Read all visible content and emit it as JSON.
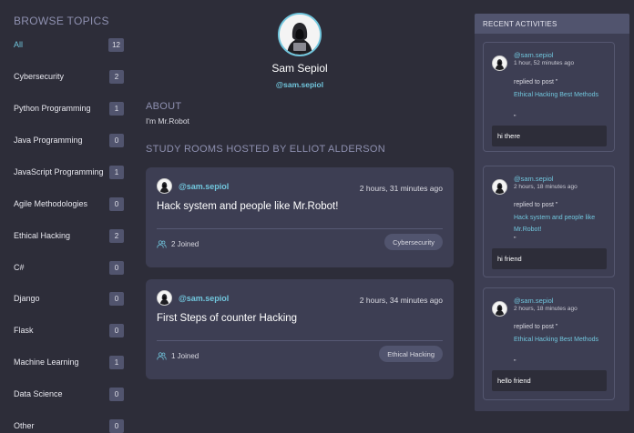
{
  "sidebar": {
    "title": "BROWSE TOPICS",
    "topics": [
      {
        "name": "All",
        "count": "12"
      },
      {
        "name": "Cybersecurity",
        "count": "2"
      },
      {
        "name": "Python Programming",
        "count": "1"
      },
      {
        "name": "Java Programming",
        "count": "0"
      },
      {
        "name": "JavaScript Programming",
        "count": "1"
      },
      {
        "name": "Agile Methodologies",
        "count": "0"
      },
      {
        "name": "Ethical Hacking",
        "count": "2"
      },
      {
        "name": "C#",
        "count": "0"
      },
      {
        "name": "Django",
        "count": "0"
      },
      {
        "name": "Flask",
        "count": "0"
      },
      {
        "name": "Machine Learning",
        "count": "1"
      },
      {
        "name": "Data Science",
        "count": "0"
      },
      {
        "name": "Other",
        "count": "0"
      }
    ]
  },
  "profile": {
    "name": "Sam Sepiol",
    "handle": "@sam.sepiol",
    "about_heading": "ABOUT",
    "about_text": "I'm Mr.Robot",
    "rooms_heading": "STUDY ROOMS HOSTED BY ELLIOT ALDERSON"
  },
  "rooms": [
    {
      "handle": "@sam.sepiol",
      "time": "2 hours, 31 minutes ago",
      "title": "Hack system and people like Mr.Robot!",
      "joined": "2 Joined",
      "topic": "Cybersecurity"
    },
    {
      "handle": "@sam.sepiol",
      "time": "2 hours, 34 minutes ago",
      "title": "First Steps of counter Hacking",
      "joined": "1 Joined",
      "topic": "Ethical Hacking"
    }
  ],
  "activities": {
    "heading": "RECENT ACTIVITIES",
    "items": [
      {
        "handle": "@sam.sepiol",
        "time": "1 hour, 52 minutes ago",
        "desc": "replied to post \"",
        "link": "Ethical Hacking Best Methods",
        "quote": "\"",
        "message": "hi there"
      },
      {
        "handle": "@sam.sepiol",
        "time": "2 hours, 18 minutes ago",
        "desc": "replied to post \"",
        "link": "Hack system and people like Mr.Robot!",
        "quote": "\"",
        "message": "hi friend"
      },
      {
        "handle": "@sam.sepiol",
        "time": "2 hours, 18 minutes ago",
        "desc": "replied to post \"",
        "link": "Ethical Hacking Best Methods",
        "quote": "\"",
        "message": "hello friend"
      }
    ]
  },
  "colors": {
    "background": "#2d2d39",
    "card": "#3d3e53",
    "accent": "#71c6dd",
    "muted_heading": "#8e90b0"
  }
}
